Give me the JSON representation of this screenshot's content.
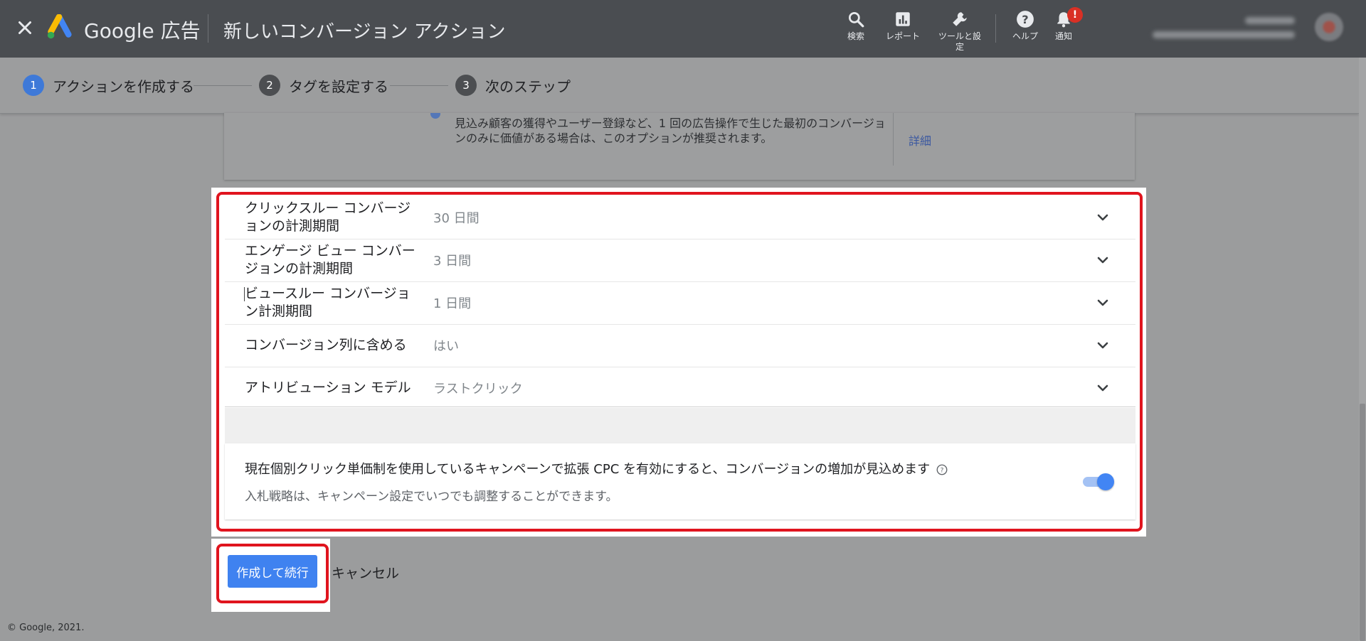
{
  "header": {
    "brand": "Google 広告",
    "page_title": "新しいコンバージョン アクション",
    "tools": [
      {
        "label": "検索",
        "icon": "search-icon"
      },
      {
        "label": "レポート",
        "icon": "reports-icon"
      },
      {
        "label": "ツールと設定",
        "icon": "wrench-icon"
      },
      {
        "label": "ヘルプ",
        "icon": "help-icon"
      },
      {
        "label": "通知",
        "icon": "bell-icon"
      }
    ],
    "notification_badge": "!"
  },
  "stepper": {
    "steps": [
      {
        "number": "1",
        "label": "アクションを作成する",
        "active": true
      },
      {
        "number": "2",
        "label": "タグを設定する",
        "active": false
      },
      {
        "number": "3",
        "label": "次のステップ",
        "active": false
      }
    ]
  },
  "prev_option": {
    "description": "見込み顧客の獲得やユーザー登録など、1 回の広告操作で生じた最初のコンバージョンのみに価値がある場合は、このオプションが推奨されます。",
    "details_link": "詳細"
  },
  "settings": {
    "rows": [
      {
        "label": "クリックスルー コンバージョンの計測期間",
        "value": "30 日間"
      },
      {
        "label": "エンゲージ ビュー コンバージョンの計測期間",
        "value": "3 日間"
      },
      {
        "label": "ビュースルー コンバージョン計測期間",
        "value": "1 日間"
      },
      {
        "label": "コンバージョン列に含める",
        "value": "はい"
      },
      {
        "label": "アトリビューション モデル",
        "value": "ラストクリック"
      }
    ]
  },
  "ecpc": {
    "text": "現在個別クリック単価制を使用しているキャンペーンで拡張 CPC を有効にすると、コンバージョンの増加が見込めます",
    "subtext": "入札戦略は、キャンペーン設定でいつでも調整することができます。",
    "enabled": true
  },
  "actions": {
    "primary": "作成して続行",
    "cancel": "キャンセル"
  },
  "footer": {
    "copyright": "© Google, 2021."
  },
  "colors": {
    "highlight": "#e0141e",
    "primary_button": "#3f82f0",
    "topbar": "#4a4d51",
    "toggle_on": "#4285f4"
  }
}
